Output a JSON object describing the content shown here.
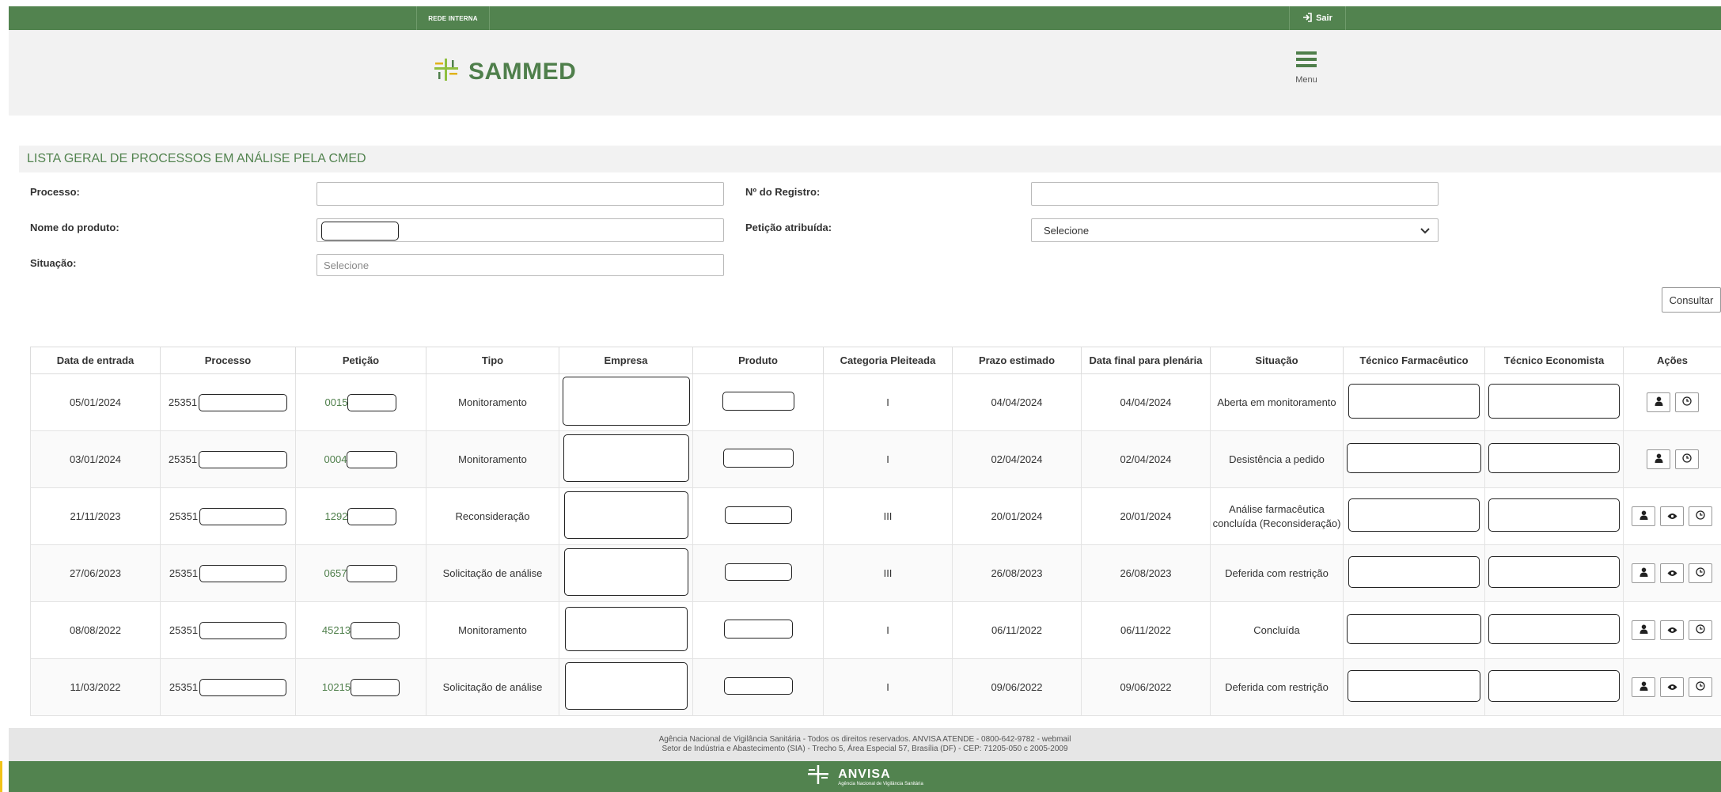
{
  "topbar": {
    "network_label": "REDE INTERNA",
    "logout_label": "Sair"
  },
  "header": {
    "app_title": "SAMMED",
    "menu_label": "Menu"
  },
  "section": {
    "title": "LISTA GERAL DE PROCESSOS EM ANÁLISE PELA CMED"
  },
  "filters": {
    "processo_label": "Processo:",
    "registro_label": "Nº do Registro:",
    "nome_label": "Nome do produto:",
    "peticao_label": "Petição atribuída:",
    "peticao_value": "Selecione",
    "situacao_label": "Situação:",
    "situacao_placeholder": "Selecione",
    "consultar_label": "Consultar"
  },
  "table": {
    "headers": [
      "Data de entrada",
      "Processo",
      "Petição",
      "Tipo",
      "Empresa",
      "Produto",
      "Categoria Pleiteada",
      "Prazo estimado",
      "Data final para plenária",
      "Situação",
      "Técnico Farmacêutico",
      "Técnico Economista",
      "Ações"
    ],
    "rows": [
      {
        "data_entrada": "05/01/2024",
        "processo": "25351",
        "peticao": "0015",
        "tipo": "Monitoramento",
        "categoria": "I",
        "prazo": "04/04/2024",
        "data_final": "04/04/2024",
        "situacao": "Aberta em monitoramento"
      },
      {
        "data_entrada": "03/01/2024",
        "processo": "25351",
        "peticao": "0004",
        "tipo": "Monitoramento",
        "categoria": "I",
        "prazo": "02/04/2024",
        "data_final": "02/04/2024",
        "situacao": "Desistência a pedido"
      },
      {
        "data_entrada": "21/11/2023",
        "processo": "25351",
        "peticao": "1292",
        "tipo": "Reconsideração",
        "categoria": "III",
        "prazo": "20/01/2024",
        "data_final": "20/01/2024",
        "situacao": "Análise farmacêutica concluída (Reconsideração)"
      },
      {
        "data_entrada": "27/06/2023",
        "processo": "25351",
        "peticao": "0657",
        "tipo": "Solicitação de análise",
        "categoria": "III",
        "prazo": "26/08/2023",
        "data_final": "26/08/2023",
        "situacao": "Deferida com restrição"
      },
      {
        "data_entrada": "08/08/2022",
        "processo": "25351",
        "peticao": "45213",
        "tipo": "Monitoramento",
        "categoria": "I",
        "prazo": "06/11/2022",
        "data_final": "06/11/2022",
        "situacao": "Concluída"
      },
      {
        "data_entrada": "11/03/2022",
        "processo": "25351",
        "peticao": "10215",
        "tipo": "Solicitação de análise",
        "categoria": "I",
        "prazo": "09/06/2022",
        "data_final": "09/06/2022",
        "situacao": "Deferida com restrição"
      }
    ]
  },
  "footer": {
    "line1": "Agência Nacional de Vigilância Sanitária - Todos os direitos reservados. ANVISA ATENDE - 0800-642-9782 - webmail",
    "line2": "Setor de Indústria e Abastecimento (SIA) - Trecho 5, Área Especial 57, Brasília (DF) - CEP: 71205-050 c 2005-2009",
    "brand": "ANVISA",
    "brand_sub": "Agência Nacional de Vigilância Sanitária"
  },
  "colors": {
    "brand_green": "#52834f",
    "header_bg": "#f2f2f2",
    "accent_yellow": "#f2c318"
  },
  "icons": [
    "sign-in-icon",
    "hamburger-menu-icon",
    "sammed-logo-icon",
    "user-icon",
    "eye-icon",
    "clock-icon",
    "chevron-down-icon",
    "anvisa-logo-icon"
  ]
}
